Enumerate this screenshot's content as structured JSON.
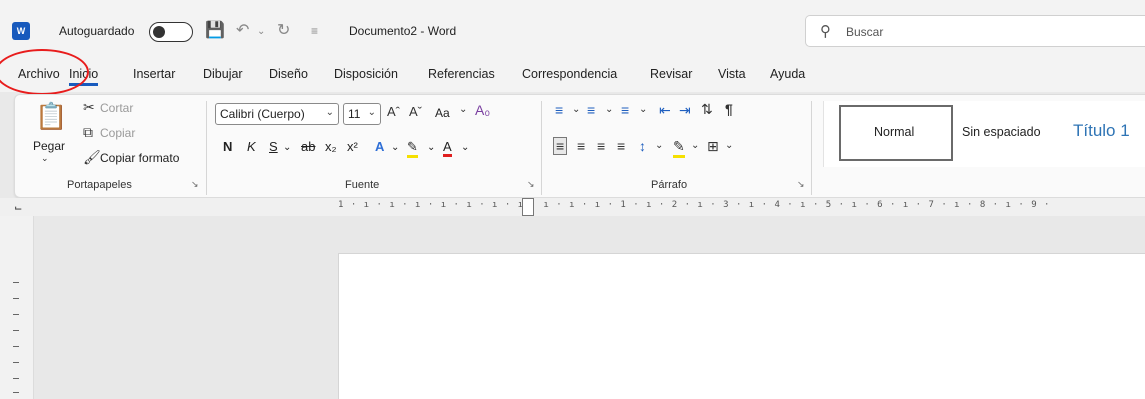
{
  "titlebar": {
    "app_icon": "W",
    "autosave_label": "Autoguardado",
    "doc_title": "Documento2 - Word",
    "search_placeholder": "Buscar"
  },
  "tabs": [
    "Archivo",
    "Inicio",
    "Insertar",
    "Dibujar",
    "Diseño",
    "Disposición",
    "Referencias",
    "Correspondencia",
    "Revisar",
    "Vista",
    "Ayuda"
  ],
  "ribbon": {
    "clipboard": {
      "paste": "Pegar",
      "cut": "Cortar",
      "copy": "Copiar",
      "format_painter": "Copiar formato",
      "label": "Portapapeles"
    },
    "font": {
      "font_name": "Calibri (Cuerpo)",
      "font_size": "11",
      "change_case": "Aa",
      "bold": "N",
      "italic": "K",
      "underline": "S",
      "label": "Fuente"
    },
    "paragraph": {
      "label": "Párrafo"
    },
    "styles": {
      "normal": "Normal",
      "no_spacing": "Sin espaciado",
      "heading1": "Título 1"
    }
  },
  "ruler": {
    "numbers": "1 · ı · ı · ı · ı · ı · ı · ı · ı · ı · ı · 1 · ı · 2 · ı · 3 · ı · 4 · ı · 5 · ı · 6 · ı · 7 · ı · 8 · ı · 9 ·"
  }
}
